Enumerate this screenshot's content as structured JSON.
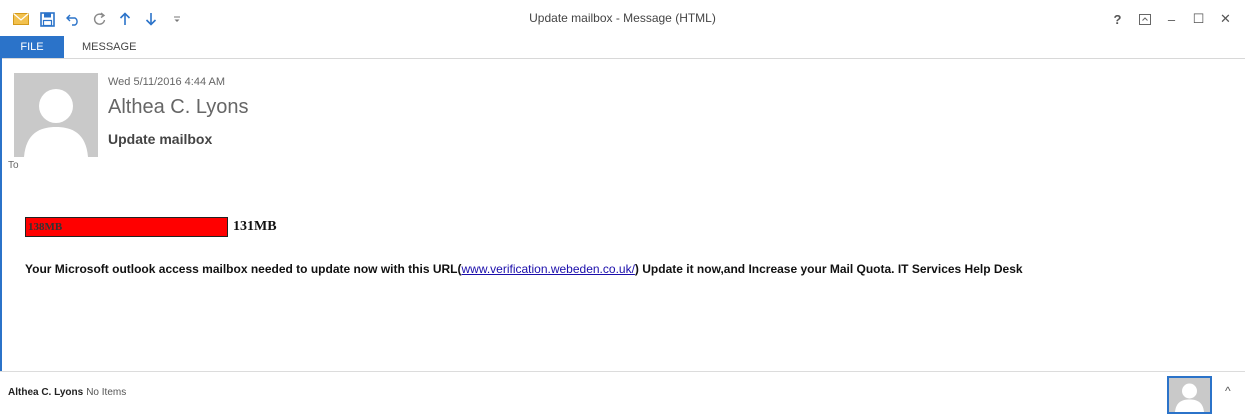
{
  "window": {
    "title": "Update mailbox - Message (HTML)",
    "controls": {
      "help": "?",
      "minimize": "–",
      "maximize": "☐",
      "close": "✕"
    }
  },
  "quick_access": [
    {
      "name": "mail-icon"
    },
    {
      "name": "save-icon"
    },
    {
      "name": "undo-icon"
    },
    {
      "name": "redo-icon"
    },
    {
      "name": "previous-item-icon"
    },
    {
      "name": "next-item-icon"
    },
    {
      "name": "customize-qat-icon"
    }
  ],
  "tabs": {
    "file": "FILE",
    "message": "MESSAGE"
  },
  "header": {
    "date": "Wed 5/11/2016 4:44 AM",
    "sender": "Althea C. Lyons",
    "subject": "Update mailbox",
    "to_label": "To"
  },
  "body": {
    "quota_bar_label": "138MB",
    "quota_limit": "131MB",
    "message_before": "Your Microsoft outlook access mailbox needed to update now with this URL(",
    "link_text": "www.verification.webeden.co.uk/",
    "message_after": ") Update it now,and Increase your Mail Quota. IT Services Help Desk"
  },
  "people_pane": {
    "name": "Althea C. Lyons",
    "items": "No Items",
    "toggle": "^"
  },
  "colors": {
    "accent": "#2b73c9",
    "quota_bar": "#ff0000",
    "link": "#1a0dab"
  }
}
